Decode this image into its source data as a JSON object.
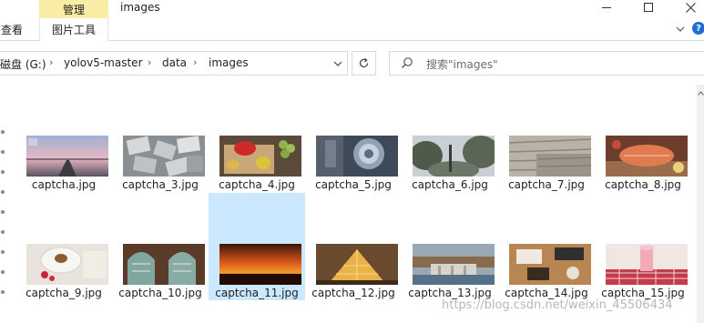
{
  "window": {
    "manage_tab": "管理",
    "title": "images"
  },
  "ribbon": {
    "view_tab": "查看",
    "picture_tools_tab": "图片工具",
    "help_label": "?"
  },
  "address": {
    "drive": "磁盘 (G:)",
    "folder1": "yolov5-master",
    "folder2": "data",
    "folder3": "images",
    "separator": "›"
  },
  "search": {
    "placeholder": "搜索\"images\""
  },
  "files": [
    {
      "name": "captcha.jpg",
      "icon": "image-thumbnail-road"
    },
    {
      "name": "captcha_3.jpg",
      "icon": "image-thumbnail-pills"
    },
    {
      "name": "captcha_4.jpg",
      "icon": "image-thumbnail-fruit"
    },
    {
      "name": "captcha_5.jpg",
      "icon": "image-thumbnail-street-art"
    },
    {
      "name": "captcha_6.jpg",
      "icon": "image-thumbnail-trees"
    },
    {
      "name": "captcha_7.jpg",
      "icon": "image-thumbnail-wood"
    },
    {
      "name": "captcha_8.jpg",
      "icon": "image-thumbnail-salmon"
    },
    {
      "name": "captcha_9.jpg",
      "icon": "image-thumbnail-dessert"
    },
    {
      "name": "captcha_10.jpg",
      "icon": "image-thumbnail-arches"
    },
    {
      "name": "captcha_11.jpg",
      "icon": "image-thumbnail-sunset"
    },
    {
      "name": "captcha_12.jpg",
      "icon": "image-thumbnail-pyramid"
    },
    {
      "name": "captcha_13.jpg",
      "icon": "image-thumbnail-dam"
    },
    {
      "name": "captcha_14.jpg",
      "icon": "image-thumbnail-desk"
    },
    {
      "name": "captcha_15.jpg",
      "icon": "image-thumbnail-drink"
    }
  ],
  "selected_file": "captcha_11.jpg",
  "watermark": "https://blog.csdn.net/weixin_45506434",
  "colors": {
    "manage_tab_bg": "#f9eca4",
    "selection_bg": "#cce8ff",
    "hover_bg": "#e5f3ff"
  }
}
